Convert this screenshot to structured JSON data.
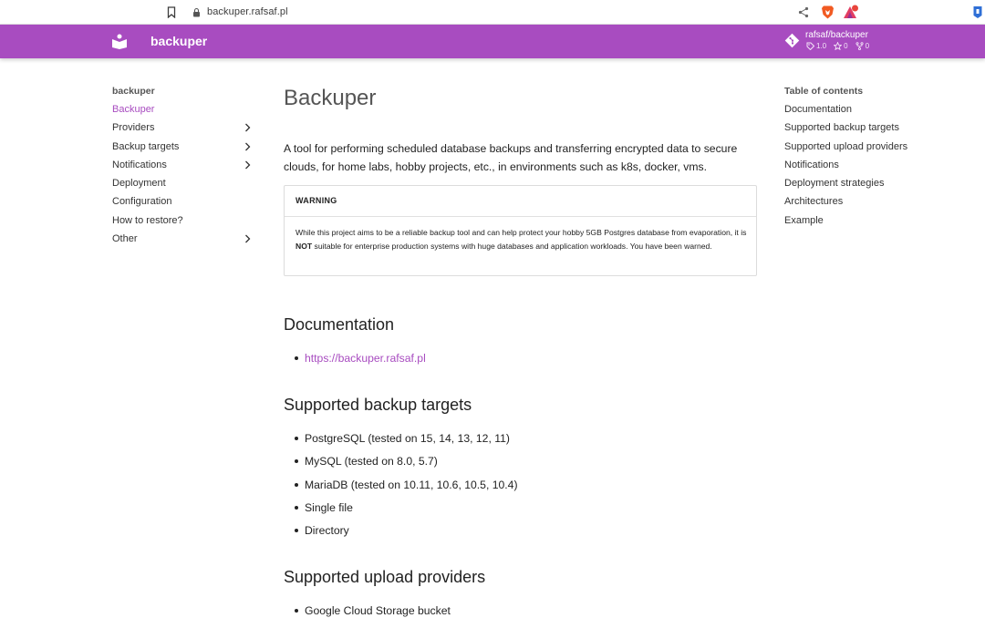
{
  "browser": {
    "url": "backuper.rafsaf.pl",
    "icons": [
      "bookmark-icon",
      "lock-icon",
      "share-icon",
      "brave-icon",
      "brave-rewards-icon",
      "extension-icon"
    ]
  },
  "header": {
    "title": "backuper",
    "repo": {
      "name": "rafsaf/backuper",
      "version": "1.0",
      "stars": "0",
      "forks": "0"
    },
    "accent_color": "#a84cc0"
  },
  "sidebar": {
    "heading": "backuper",
    "items": [
      {
        "label": "Backuper",
        "active": true,
        "expandable": false
      },
      {
        "label": "Providers",
        "active": false,
        "expandable": true
      },
      {
        "label": "Backup targets",
        "active": false,
        "expandable": true
      },
      {
        "label": "Notifications",
        "active": false,
        "expandable": true
      },
      {
        "label": "Deployment",
        "active": false,
        "expandable": false
      },
      {
        "label": "Configuration",
        "active": false,
        "expandable": false
      },
      {
        "label": "How to restore?",
        "active": false,
        "expandable": false
      },
      {
        "label": "Other",
        "active": false,
        "expandable": true
      }
    ]
  },
  "main": {
    "title": "Backuper",
    "intro": "A tool for performing scheduled database backups and transferring encrypted data to secure clouds, for home labs, hobby projects, etc., in environments such as k8s, docker, vms.",
    "warning": {
      "title": "WARNING",
      "body_before": "While this project aims to be a reliable backup tool and can help protect your hobby 5GB Postgres database from evaporation, it is ",
      "body_bold": "NOT",
      "body_after": " suitable for enterprise production systems with huge databases and application workloads. You have been warned."
    },
    "documentation": {
      "heading": "Documentation",
      "link": "https://backuper.rafsaf.pl"
    },
    "backup_targets": {
      "heading": "Supported backup targets",
      "items": [
        "PostgreSQL (tested on 15, 14, 13, 12, 11)",
        "MySQL (tested on 8.0, 5.7)",
        "MariaDB (tested on 10.11, 10.6, 10.5, 10.4)",
        "Single file",
        "Directory"
      ]
    },
    "upload_providers": {
      "heading": "Supported upload providers",
      "items": [
        "Google Cloud Storage bucket"
      ]
    }
  },
  "toc": {
    "heading": "Table of contents",
    "items": [
      "Documentation",
      "Supported backup targets",
      "Supported upload providers",
      "Notifications",
      "Deployment strategies",
      "Architectures",
      "Example"
    ]
  }
}
